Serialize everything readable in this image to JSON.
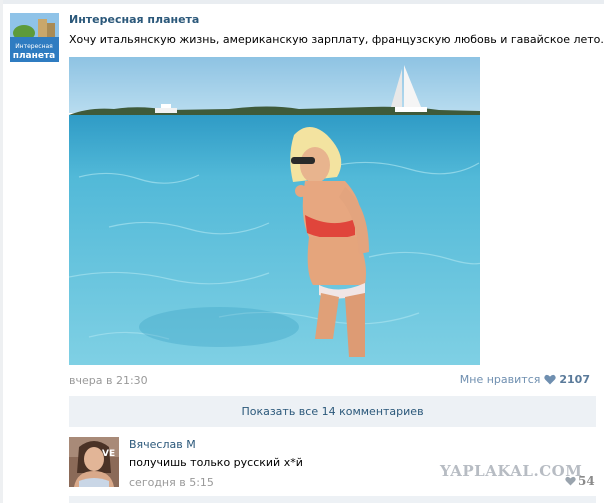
{
  "post": {
    "group_name": "Интересная планета",
    "avatar_text_line1": "Интересная",
    "avatar_text_line2": "планета",
    "text": "Хочу итальянскую жизнь, американскую зарплату, французскую любовь и гавайское лето...)",
    "date": "вчера в 21:30",
    "like_label": "Мне нравится",
    "like_count": "2107"
  },
  "comments_bar": {
    "show_all_label": "Показать все 14 комментариев"
  },
  "comment": {
    "author": "Вячеслав М",
    "avatar_badge": "VE",
    "text": "получишь только русский х*й",
    "date": "сегодня в 5:15",
    "like_count": "54"
  },
  "watermark": {
    "text": "YAPLAKAL.COM"
  },
  "colors": {
    "link": "#2b587a",
    "muted": "#999999",
    "like": "#6f8fb0",
    "bar": "#edf1f5",
    "sea": "#4cb3d3",
    "sky": "#9fcbe6"
  },
  "icons": {
    "like": "heart-icon",
    "comment_like": "heart-icon"
  }
}
